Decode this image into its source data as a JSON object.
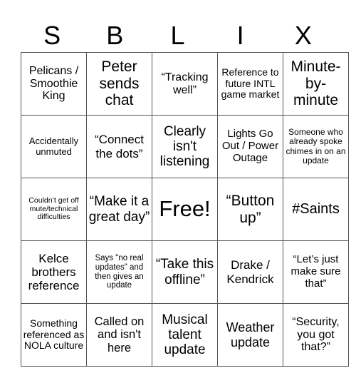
{
  "header": {
    "letters": [
      "S",
      "B",
      "L",
      "I",
      "X"
    ]
  },
  "grid": [
    [
      {
        "text": "Pelicans / Smoothie King",
        "size": 16
      },
      {
        "text": "Peter sends chat",
        "size": 21
      },
      {
        "text": "“Tracking well”",
        "size": 16
      },
      {
        "text": "Reference to future INTL game market",
        "size": 14
      },
      {
        "text": "Minute-by-minute",
        "size": 21
      }
    ],
    [
      {
        "text": "Accidentally unmuted",
        "size": 13
      },
      {
        "text": "“Connect the dots”",
        "size": 17
      },
      {
        "text": "Clearly isn't listening",
        "size": 19
      },
      {
        "text": "Lights Go Out / Power Outage",
        "size": 15
      },
      {
        "text": "Someone who already spoke chimes in on an update",
        "size": 12
      }
    ],
    [
      {
        "text": "Couldn’t get off mute/technical difficulties",
        "size": 10.5
      },
      {
        "text": "“Make it a great day”",
        "size": 19
      },
      {
        "text": "Free!",
        "size": 31
      },
      {
        "text": "“Button up”",
        "size": 21
      },
      {
        "text": "#Saints",
        "size": 20
      }
    ],
    [
      {
        "text": "Kelce brothers reference",
        "size": 17
      },
      {
        "text": "Says \"no real updates\" and then gives an update",
        "size": 11.5
      },
      {
        "text": "“Take this offline”",
        "size": 19
      },
      {
        "text": "Drake / Kendrick",
        "size": 17
      },
      {
        "text": "“Let’s just make sure that”",
        "size": 15
      }
    ],
    [
      {
        "text": "Something referenced as NOLA culture",
        "size": 14
      },
      {
        "text": "Called on and isn't here",
        "size": 16.5
      },
      {
        "text": "Musical talent update",
        "size": 19
      },
      {
        "text": "Weather update",
        "size": 18
      },
      {
        "text": "“Security, you got that?”",
        "size": 16
      }
    ]
  ]
}
